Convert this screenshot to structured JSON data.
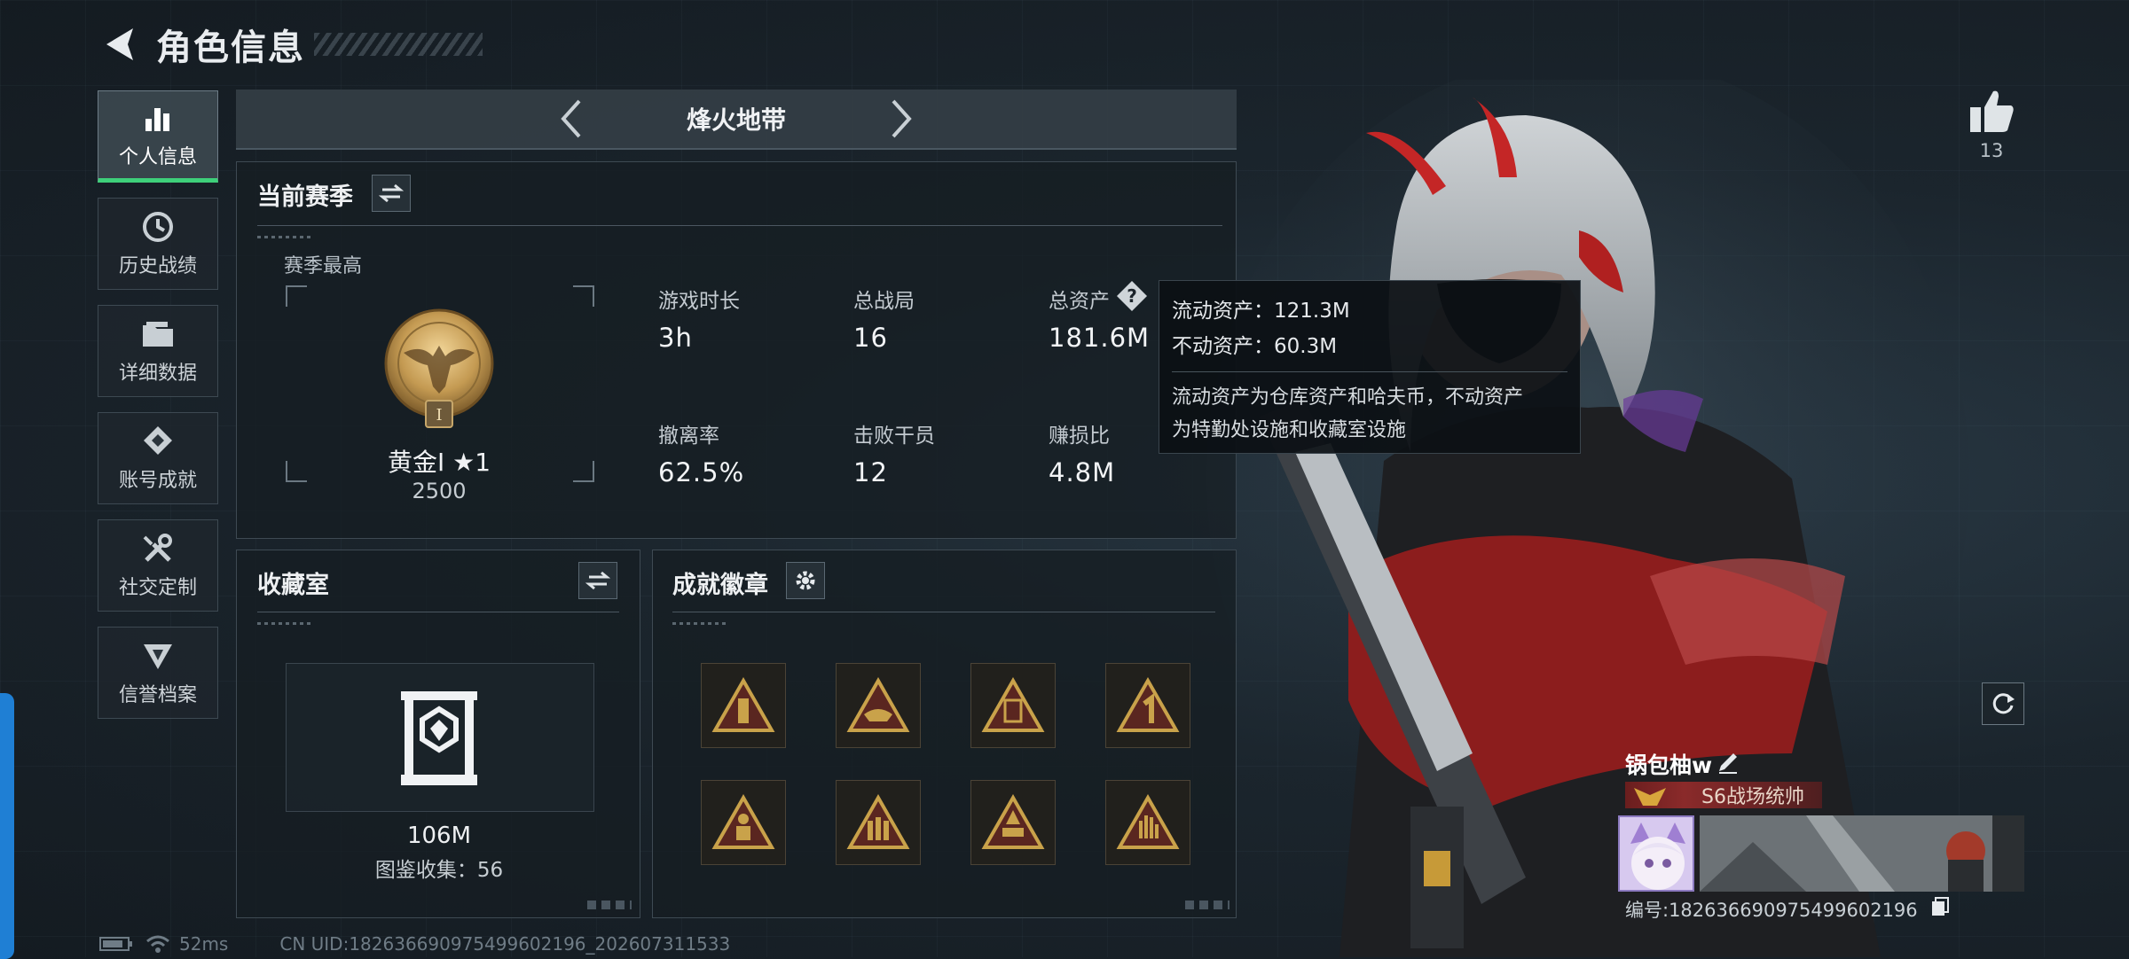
{
  "header": {
    "title": "角色信息"
  },
  "sidebar": {
    "items": [
      {
        "label": "个人信息",
        "icon": "bar-chart-icon",
        "active": true
      },
      {
        "label": "历史战绩",
        "icon": "history-clock-icon",
        "active": false
      },
      {
        "label": "详细数据",
        "icon": "folder-icon",
        "active": false
      },
      {
        "label": "账号成就",
        "icon": "achievement-icon",
        "active": false
      },
      {
        "label": "社交定制",
        "icon": "tools-icon",
        "active": false
      },
      {
        "label": "信誉档案",
        "icon": "reputation-icon",
        "active": false
      }
    ]
  },
  "mode_bar": {
    "name": "烽火地带"
  },
  "season": {
    "title": "当前赛季",
    "subtitle": "赛季最高",
    "rank": {
      "name": "黄金I ★1",
      "points": "2500",
      "emblem_numeral": "I"
    },
    "stats": [
      {
        "label": "游戏时长",
        "value": "3h"
      },
      {
        "label": "总战局",
        "value": "16"
      },
      {
        "label": "总资产",
        "value": "181.6M"
      },
      {
        "label": "撤离率",
        "value": "62.5%"
      },
      {
        "label": "击败干员",
        "value": "12"
      },
      {
        "label": "赚损比",
        "value": "4.8M"
      }
    ]
  },
  "tooltip": {
    "liquid": "流动资产：121.3M",
    "fixed": "不动资产：60.3M",
    "desc_line1": "流动资产为仓库资产和哈夫币，不动资产",
    "desc_line2": "为特勤处设施和收藏室设施"
  },
  "collection": {
    "title": "收藏室",
    "value": "106M",
    "count_text": "图鉴收集：56"
  },
  "badges": {
    "title": "成就徽章",
    "items": [
      "tower-badge-icon",
      "boat-badge-icon",
      "stamp-badge-icon",
      "number-one-badge-icon",
      "soldier-badge-icon",
      "ammo-badge-icon",
      "s6-badge-icon",
      "hand-badge-icon"
    ]
  },
  "profile": {
    "likes": "13",
    "player_name": "锅包柚w",
    "title_tag": "S6战场统帅",
    "id_text": "编号:1826366909754996021​96"
  },
  "footer": {
    "ping": "52ms",
    "uid": "CN UID:1826366909754996021​96_202607311533"
  },
  "colors": {
    "accent_green": "#3ed07a",
    "badge_gold": "#c9a24a",
    "title_red": "#8a2a2a"
  }
}
